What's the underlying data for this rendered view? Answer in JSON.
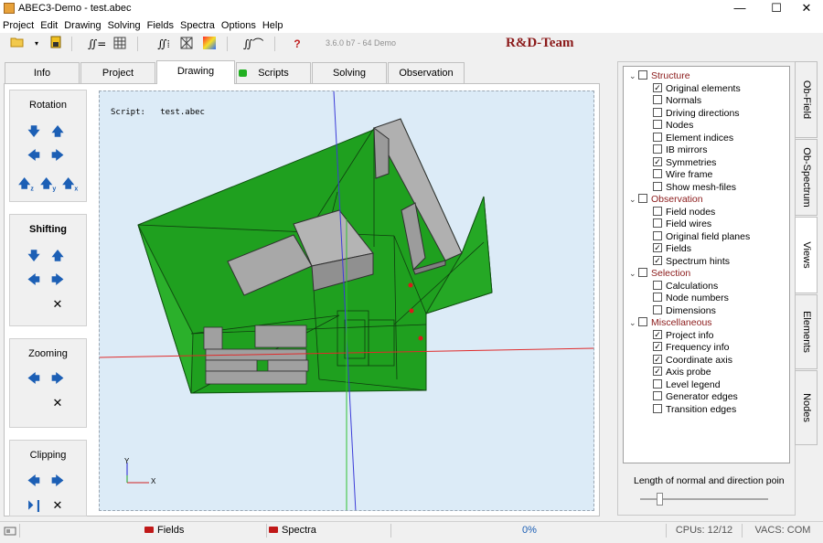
{
  "window": {
    "title": "ABEC3-Demo - test.abec",
    "minimize": "—",
    "maximize": "☐",
    "close": "✕"
  },
  "menu": [
    "Project",
    "Edit",
    "Drawing",
    "Solving",
    "Fields",
    "Spectra",
    "Options",
    "Help"
  ],
  "toolbar": {
    "version": "3.6.0 b7 - 64 Demo",
    "team": "R&D-Team",
    "help": "?"
  },
  "tabs": [
    {
      "label": "Info"
    },
    {
      "label": "Project"
    },
    {
      "label": "Drawing",
      "active": true
    },
    {
      "label": "Scripts",
      "indicator": "#22b022"
    },
    {
      "label": "Solving"
    },
    {
      "label": "Observation"
    }
  ],
  "controls": {
    "rotation": {
      "title": "Rotation",
      "axes": [
        "z",
        "y",
        "x"
      ]
    },
    "shifting": {
      "title": "Shifting"
    },
    "zooming": {
      "title": "Zooming"
    },
    "clipping": {
      "title": "Clipping"
    }
  },
  "viewport": {
    "script_label": "Script:",
    "script_file": "test.abec",
    "axis_y": "Y",
    "axis_x": "X"
  },
  "tree": [
    {
      "label": "Structure",
      "level": 0,
      "checked": false,
      "category": true
    },
    {
      "label": "Original elements",
      "level": 1,
      "checked": true
    },
    {
      "label": "Normals",
      "level": 1,
      "checked": false
    },
    {
      "label": "Driving directions",
      "level": 1,
      "checked": false
    },
    {
      "label": "Nodes",
      "level": 1,
      "checked": false
    },
    {
      "label": "Element indices",
      "level": 1,
      "checked": false
    },
    {
      "label": "IB mirrors",
      "level": 1,
      "checked": false
    },
    {
      "label": "Symmetries",
      "level": 1,
      "checked": true
    },
    {
      "label": "Wire frame",
      "level": 1,
      "checked": false
    },
    {
      "label": "Show mesh-files",
      "level": 1,
      "checked": false
    },
    {
      "label": "Observation",
      "level": 0,
      "checked": false,
      "category": true
    },
    {
      "label": "Field nodes",
      "level": 1,
      "checked": false
    },
    {
      "label": "Field wires",
      "level": 1,
      "checked": false
    },
    {
      "label": "Original field planes",
      "level": 1,
      "checked": false
    },
    {
      "label": "Fields",
      "level": 1,
      "checked": true
    },
    {
      "label": "Spectrum hints",
      "level": 1,
      "checked": true
    },
    {
      "label": "Selection",
      "level": 0,
      "checked": false,
      "category": true
    },
    {
      "label": "Calculations",
      "level": 1,
      "checked": false
    },
    {
      "label": "Node numbers",
      "level": 1,
      "checked": false
    },
    {
      "label": "Dimensions",
      "level": 1,
      "checked": false
    },
    {
      "label": "Miscellaneous",
      "level": 0,
      "checked": false,
      "category": true
    },
    {
      "label": "Project info",
      "level": 1,
      "checked": true
    },
    {
      "label": "Frequency info",
      "level": 1,
      "checked": true
    },
    {
      "label": "Coordinate axis",
      "level": 1,
      "checked": true
    },
    {
      "label": "Axis probe",
      "level": 1,
      "checked": true
    },
    {
      "label": "Level legend",
      "level": 1,
      "checked": false
    },
    {
      "label": "Generator edges",
      "level": 1,
      "checked": false
    },
    {
      "label": "Transition edges",
      "level": 1,
      "checked": false
    }
  ],
  "slider": {
    "label": "Length of normal and direction poin",
    "value": 0.15
  },
  "side_tabs": [
    "Ob-Field",
    "Ob-Spectrum",
    "Views",
    "Elements",
    "Nodes"
  ],
  "status": {
    "fields": "Fields",
    "spectra": "Spectra",
    "progress": "0%",
    "cpus": "CPUs: 12/12",
    "vacs": "VACS: COM"
  }
}
